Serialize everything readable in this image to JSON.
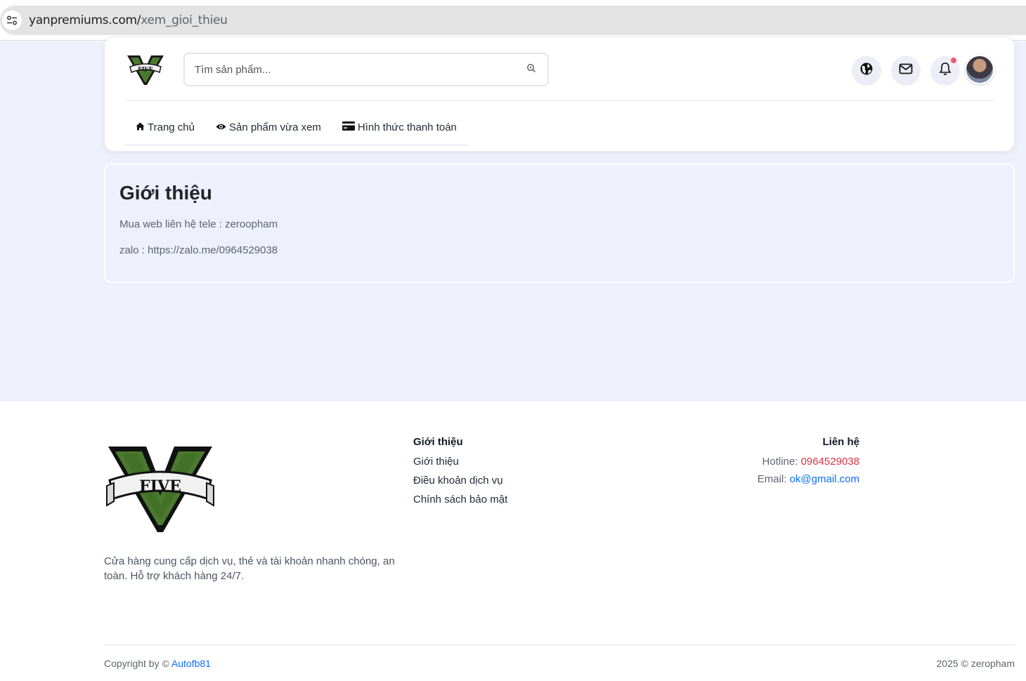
{
  "browser": {
    "url_host": "yanpremiums.com/",
    "url_path": "xem_gioi_thieu"
  },
  "header": {
    "logo_alt": "GTA V FIVE logo",
    "search_placeholder": "Tìm sản phẩm...",
    "icons": [
      "globe-icon",
      "mail-icon",
      "bell-icon",
      "avatar"
    ],
    "nav": [
      {
        "label": "Trang chủ",
        "icon": "home-icon"
      },
      {
        "label": "Sản phẩm vừa xem",
        "icon": "eye-icon"
      },
      {
        "label": "Hình thức thanh toán",
        "icon": "credit-card-icon"
      }
    ]
  },
  "about": {
    "title": "Giới thiệu",
    "line1": "Mua web liên hệ tele : zeroopham",
    "line2": "zalo : https://zalo.me/0964529038"
  },
  "footer": {
    "description": "Cửa hàng cung cấp dịch vụ, thẻ và tài khoản nhanh chóng, an toàn. Hỗ trợ khách hàng 24/7.",
    "col1": {
      "title": "Giới thiệu",
      "links": [
        "Giới thiệu",
        "Điều khoản dịch vụ",
        "Chính sách bảo mật"
      ]
    },
    "col2": {
      "title": "Liên hệ",
      "hotline_label": "Hotline: ",
      "hotline_value": "0964529038",
      "email_label": "Email: ",
      "email_value": "ok@gmail.com"
    },
    "copyright_prefix": "Copyright by © ",
    "copyright_brand": "Autofb81",
    "year_note": "2025 © zeropham"
  },
  "colors": {
    "page_bg": "#eef0fc",
    "accent_red": "#dc3545",
    "accent_blue": "#0d6efd",
    "notification_dot": "#f05a6b"
  }
}
